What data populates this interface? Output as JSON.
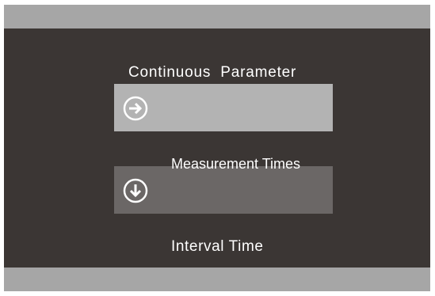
{
  "menu": {
    "title": "Continuous  Parameter",
    "items": [
      {
        "label": "Measurement Times",
        "icon": "arrow-right-circle-icon"
      },
      {
        "label": "Interval Time",
        "icon": "arrow-down-circle-icon"
      }
    ]
  },
  "colors": {
    "frame": "#a6a6a6",
    "screen": "#3b3634",
    "selected_row": "#b3b3b3",
    "unselected_row": "#6b6766",
    "text": "#ffffff"
  }
}
